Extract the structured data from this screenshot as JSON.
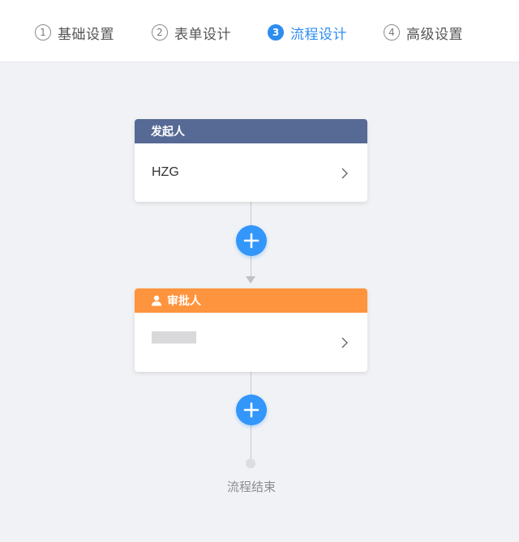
{
  "steps": [
    {
      "number": "1",
      "label": "基础设置"
    },
    {
      "number": "2",
      "label": "表单设计"
    },
    {
      "number": "3",
      "label": "流程设计"
    },
    {
      "number": "4",
      "label": "高级设置"
    }
  ],
  "active_step": 3,
  "flow": {
    "initiator": {
      "title": "发起人",
      "value": "HZG",
      "header_color": "#576a95"
    },
    "approver": {
      "title": "审批人",
      "value": "",
      "header_color": "#ff943e",
      "icon": "user-icon"
    },
    "add_button_icon": "plus-icon",
    "add_button_color": "#3296fa",
    "end_label": "流程结束"
  },
  "colors": {
    "accent": "#2d8cf0",
    "background": "#f1f2f5"
  }
}
